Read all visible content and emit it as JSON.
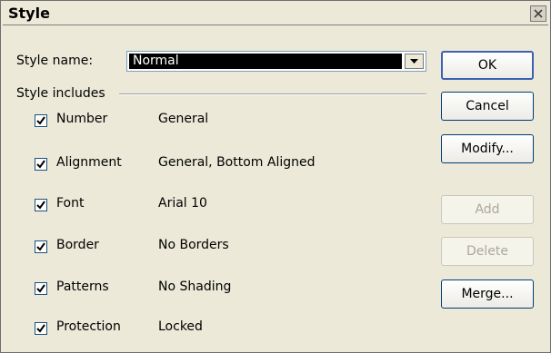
{
  "window": {
    "title": "Style"
  },
  "style_name": {
    "label": "Style name:",
    "value": "Normal"
  },
  "group": {
    "label": "Style includes"
  },
  "options": [
    {
      "label": "Number",
      "value": "General",
      "checked": true
    },
    {
      "label": "Alignment",
      "value": "General, Bottom Aligned",
      "checked": true
    },
    {
      "label": "Font",
      "value": "Arial 10",
      "checked": true
    },
    {
      "label": "Border",
      "value": "No Borders",
      "checked": true
    },
    {
      "label": "Patterns",
      "value": "No Shading",
      "checked": true
    },
    {
      "label": "Protection",
      "value": "Locked",
      "checked": true
    }
  ],
  "buttons": {
    "ok": "OK",
    "cancel": "Cancel",
    "modify": "Modify...",
    "add": "Add",
    "delete": "Delete",
    "merge": "Merge..."
  }
}
